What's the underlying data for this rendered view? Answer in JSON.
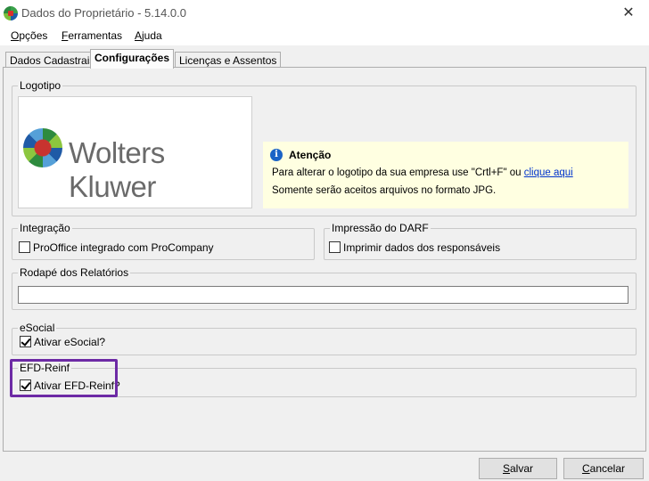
{
  "window": {
    "title": "Dados do Proprietário - 5.14.0.0",
    "close_glyph": "✕"
  },
  "menu": [
    {
      "underline": "O",
      "rest": "pções"
    },
    {
      "underline": "F",
      "rest": "erramentas"
    },
    {
      "underline": "A",
      "rest": "juda"
    }
  ],
  "tabs": [
    "Dados Cadastrais",
    "Configurações",
    "Licenças e Assentos"
  ],
  "active_tab": "Configurações",
  "logotipo": {
    "label": "Logotipo",
    "logo_text": "Wolters Kluwer",
    "notice_title": "Atenção",
    "notice_line1": "Para alterar o logotipo da sua empresa use \"Crtl+F\" ou",
    "notice_link": "clique aqui",
    "notice_line2": "Somente serão aceitos arquivos no formato JPG."
  },
  "integracao": {
    "label": "Integração",
    "checkbox_label": "ProOffice integrado com ProCompany",
    "checked": false
  },
  "darf": {
    "label": "Impressão do DARF",
    "checkbox_label": "Imprimir dados dos responsáveis",
    "checked": false
  },
  "rodape": {
    "label": "Rodapé dos Relatórios",
    "value": ""
  },
  "esocial": {
    "label": "eSocial",
    "checkbox_label": "Ativar eSocial?",
    "checked": true
  },
  "efd": {
    "label": "EFD-Reinf",
    "checkbox_label": "Ativar EFD-Reinf?",
    "checked": true
  },
  "buttons": {
    "save": {
      "underline": "S",
      "rest": "alvar"
    },
    "cancel": {
      "underline": "C",
      "rest": "ancelar"
    }
  },
  "colors": {
    "highlight": "#6d2aa5",
    "notice_bg": "#ffffe1",
    "link": "#0033cc"
  }
}
